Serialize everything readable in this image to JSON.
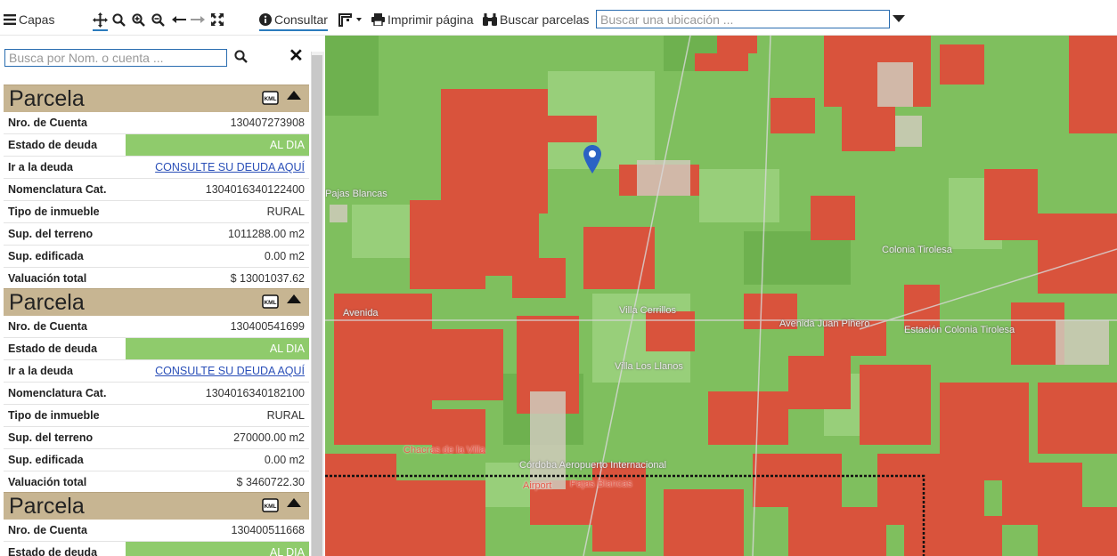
{
  "toolbar": {
    "layers_label": "Capas",
    "consult_label": "Consultar",
    "print_label": "Imprimir página",
    "find_parcels_label": "Buscar parcelas",
    "location_placeholder": "Buscar una ubicación ..."
  },
  "panel": {
    "search_placeholder": "Busca por Nom. o cuenta ...",
    "close_glyph": "✕",
    "parcels": [
      {
        "title": "Parcela",
        "rows": [
          {
            "k": "Nro. de Cuenta",
            "v": "130407273908"
          },
          {
            "k": "Estado de deuda",
            "v": "AL DIA"
          },
          {
            "k": "Ir a la deuda",
            "v": "CONSULTE SU DEUDA AQUÍ"
          },
          {
            "k": "Nomenclatura Cat.",
            "v": "1304016340122400"
          },
          {
            "k": "Tipo de inmueble",
            "v": "RURAL"
          },
          {
            "k": "Sup. del terreno",
            "v": "1011288.00 m2"
          },
          {
            "k": "Sup. edificada",
            "v": "0.00 m2"
          },
          {
            "k": "Valuación total",
            "v": "$ 13001037.62"
          }
        ]
      },
      {
        "title": "Parcela",
        "rows": [
          {
            "k": "Nro. de Cuenta",
            "v": "130400541699"
          },
          {
            "k": "Estado de deuda",
            "v": "AL DIA"
          },
          {
            "k": "Ir a la deuda",
            "v": "CONSULTE SU DEUDA AQUÍ"
          },
          {
            "k": "Nomenclatura Cat.",
            "v": "1304016340182100"
          },
          {
            "k": "Tipo de inmueble",
            "v": "RURAL"
          },
          {
            "k": "Sup. del terreno",
            "v": "270000.00 m2"
          },
          {
            "k": "Sup. edificada",
            "v": "0.00 m2"
          },
          {
            "k": "Valuación total",
            "v": "$ 3460722.30"
          }
        ]
      },
      {
        "title": "Parcela",
        "rows": [
          {
            "k": "Nro. de Cuenta",
            "v": "130400511668"
          },
          {
            "k": "Estado de deuda",
            "v": "AL DIA"
          }
        ]
      }
    ]
  },
  "map": {
    "labels": [
      "Pajas Blancas",
      "Colonia Tirolesa",
      "Avenida Juan Piñero",
      "Villa Los Llanos",
      "Estación Colonia Tirolesa",
      "Chacras de la Villa",
      "Córdoba Aeropuerto Internacional",
      "Airport",
      "Pajas Blancas",
      "Villa Cerrillos",
      "Avenida"
    ]
  },
  "colors": {
    "accent": "#2b7bbd",
    "parcel_header": "#c7b592",
    "debt_ok": "#8fcb6c",
    "map_green": "#7fbf5e",
    "map_red": "#d9533c"
  },
  "icons": [
    "hamburger-icon",
    "pan-icon",
    "search-icon",
    "zoom-in-icon",
    "zoom-out-icon",
    "arrow-left-icon",
    "arrow-right-icon",
    "fullscreen-icon",
    "info-icon",
    "draw-icon",
    "print-icon",
    "binoculars-icon",
    "kml-icon",
    "map-pin-icon"
  ]
}
